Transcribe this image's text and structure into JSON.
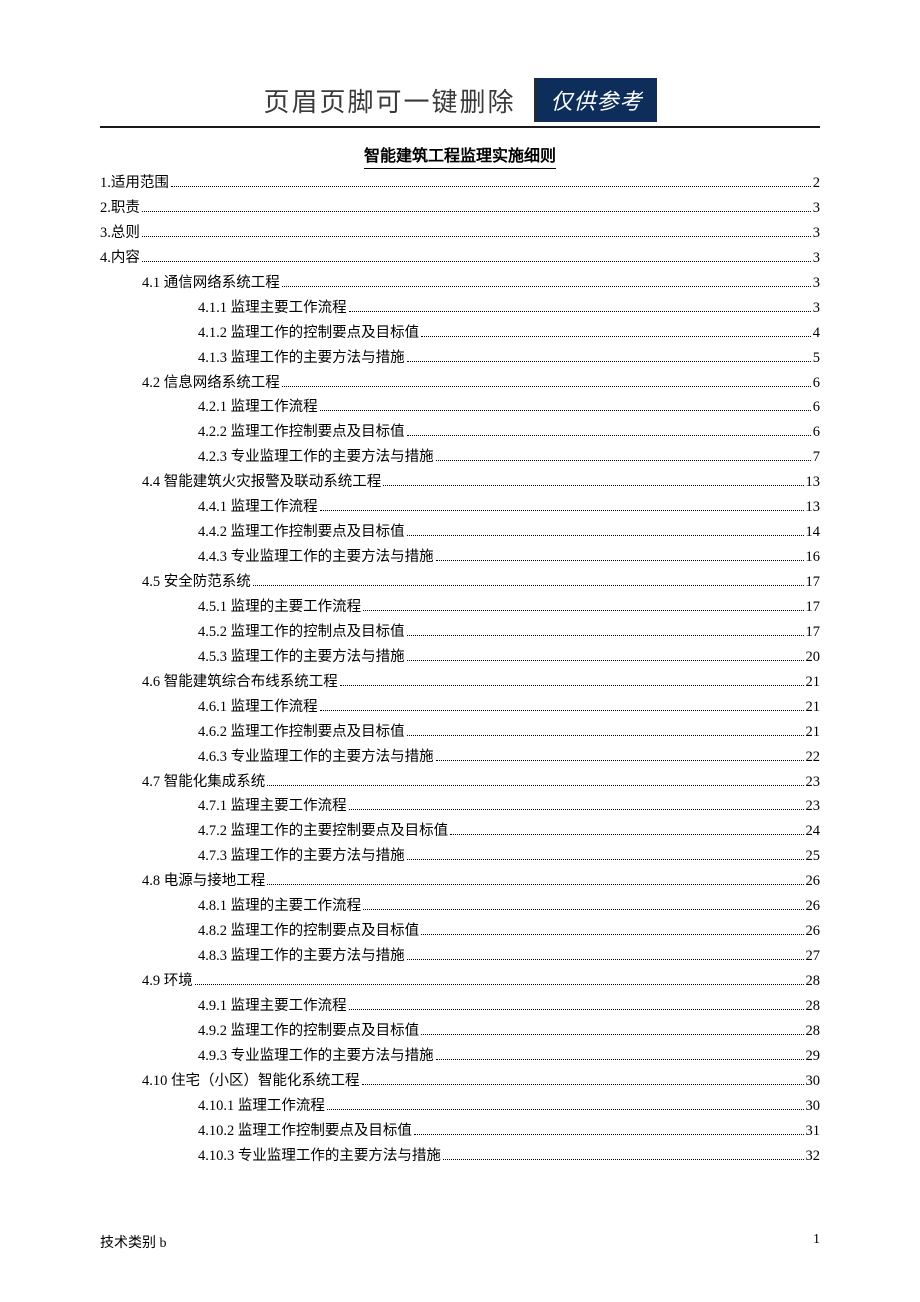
{
  "header": {
    "text": "页眉页脚可一键删除",
    "badge": "仅供参考"
  },
  "title": "智能建筑工程监理实施细则",
  "toc": [
    {
      "level": 1,
      "label": "1.适用范围",
      "page": "2"
    },
    {
      "level": 1,
      "label": "2.职责",
      "page": "3"
    },
    {
      "level": 1,
      "label": "3.总则",
      "page": "3"
    },
    {
      "level": 1,
      "label": "4.内容",
      "page": "3"
    },
    {
      "level": 2,
      "label": "4.1 通信网络系统工程",
      "page": "3"
    },
    {
      "level": 3,
      "label": "4.1.1 监理主要工作流程",
      "page": "3"
    },
    {
      "level": 3,
      "label": "4.1.2 监理工作的控制要点及目标值",
      "page": "4"
    },
    {
      "level": 3,
      "label": "4.1.3 监理工作的主要方法与措施",
      "page": "5"
    },
    {
      "level": 2,
      "label": "4.2 信息网络系统工程",
      "page": "6"
    },
    {
      "level": 3,
      "label": "4.2.1 监理工作流程",
      "page": "6"
    },
    {
      "level": 3,
      "label": "4.2.2 监理工作控制要点及目标值",
      "page": "6"
    },
    {
      "level": 3,
      "label": "4.2.3 专业监理工作的主要方法与措施",
      "page": "7"
    },
    {
      "level": 2,
      "label": "4.4 智能建筑火灾报警及联动系统工程",
      "page": "13"
    },
    {
      "level": 3,
      "label": "4.4.1 监理工作流程",
      "page": "13"
    },
    {
      "level": 3,
      "label": "4.4.2 监理工作控制要点及目标值",
      "page": "14"
    },
    {
      "level": 3,
      "label": "4.4.3 专业监理工作的主要方法与措施",
      "page": "16"
    },
    {
      "level": 2,
      "label": "4.5 安全防范系统",
      "page": "17"
    },
    {
      "level": 3,
      "label": "4.5.1 监理的主要工作流程",
      "page": "17"
    },
    {
      "level": 3,
      "label": "4.5.2 监理工作的控制点及目标值",
      "page": "17"
    },
    {
      "level": 3,
      "label": "4.5.3 监理工作的主要方法与措施",
      "page": "20"
    },
    {
      "level": 2,
      "label": "4.6 智能建筑综合布线系统工程",
      "page": "21"
    },
    {
      "level": 3,
      "label": "4.6.1 监理工作流程",
      "page": "21"
    },
    {
      "level": 3,
      "label": "4.6.2 监理工作控制要点及目标值",
      "page": "21"
    },
    {
      "level": 3,
      "label": "4.6.3 专业监理工作的主要方法与措施",
      "page": "22"
    },
    {
      "level": 2,
      "label": "4.7 智能化集成系统",
      "page": "23"
    },
    {
      "level": 3,
      "label": "4.7.1 监理主要工作流程",
      "page": "23"
    },
    {
      "level": 3,
      "label": "4.7.2 监理工作的主要控制要点及目标值",
      "page": "24"
    },
    {
      "level": 3,
      "label": "4.7.3 监理工作的主要方法与措施",
      "page": "25"
    },
    {
      "level": 2,
      "label": "4.8 电源与接地工程",
      "page": "26"
    },
    {
      "level": 3,
      "label": "4.8.1 监理的主要工作流程",
      "page": "26"
    },
    {
      "level": 3,
      "label": "4.8.2 监理工作的控制要点及目标值",
      "page": "26"
    },
    {
      "level": 3,
      "label": "4.8.3 监理工作的主要方法与措施",
      "page": "27"
    },
    {
      "level": 2,
      "label": "4.9 环境",
      "page": "28"
    },
    {
      "level": 3,
      "label": "4.9.1 监理主要工作流程",
      "page": "28"
    },
    {
      "level": 3,
      "label": "4.9.2 监理工作的控制要点及目标值",
      "page": "28"
    },
    {
      "level": 3,
      "label": "4.9.3 专业监理工作的主要方法与措施",
      "page": "29"
    },
    {
      "level": 2,
      "label": "4.10 住宅（小区）智能化系统工程",
      "page": "30"
    },
    {
      "level": 3,
      "label": "4.10.1 监理工作流程",
      "page": "30"
    },
    {
      "level": 3,
      "label": "4.10.2 监理工作控制要点及目标值",
      "page": "31"
    },
    {
      "level": 3,
      "label": "4.10.3 专业监理工作的主要方法与措施",
      "page": "32"
    }
  ],
  "footer": {
    "left": "技术类别 b",
    "right": "1"
  }
}
